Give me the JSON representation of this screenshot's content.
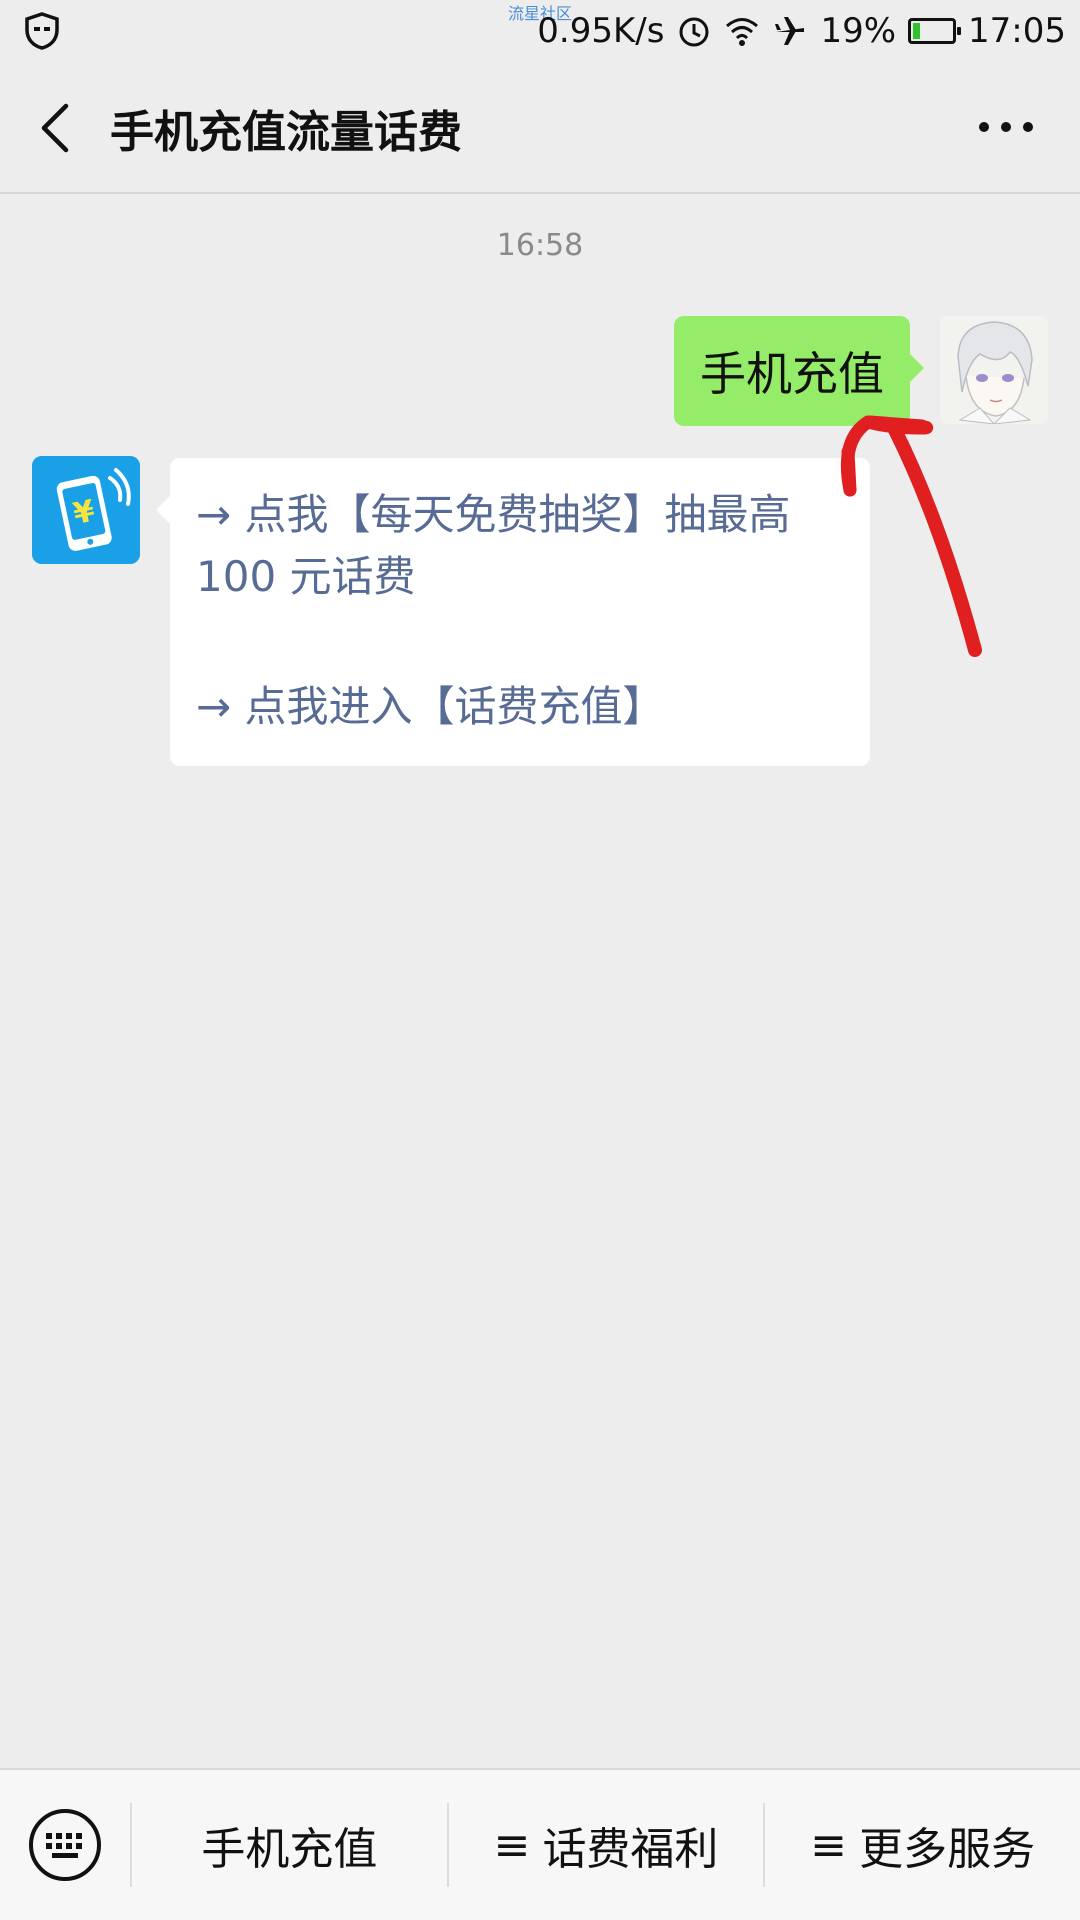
{
  "status_bar": {
    "watermark": "流星社区",
    "net_speed": "0.95K/s",
    "battery": "19%",
    "battery_level": 0.19,
    "time": "17:05",
    "icons": [
      "shield-icon",
      "alarm-icon",
      "wifi-icon",
      "airplane-icon",
      "battery-icon"
    ]
  },
  "nav": {
    "title": "手机充值流量话费",
    "back_icon": "chevron-left-icon",
    "more_icon": "more-dots-icon"
  },
  "chat": {
    "timestamp": "16:58",
    "sent_message": "手机充值",
    "received": {
      "line1": "→ 点我【每天免费抽奖】抽最高100 元话费",
      "line2": "→ 点我进入【话费充值】"
    }
  },
  "bottom_menu": {
    "keyboard_icon": "keyboard-icon",
    "items": [
      {
        "label": "手机充值",
        "prefix": ""
      },
      {
        "label": "话费福利",
        "prefix": "≡"
      },
      {
        "label": "更多服务",
        "prefix": "≡"
      }
    ]
  },
  "colors": {
    "background": "#ededed",
    "sent_bubble": "#95ec69",
    "link_text": "#576b95",
    "bot_avatar": "#1aa0e6",
    "annotation": "#e02020"
  }
}
